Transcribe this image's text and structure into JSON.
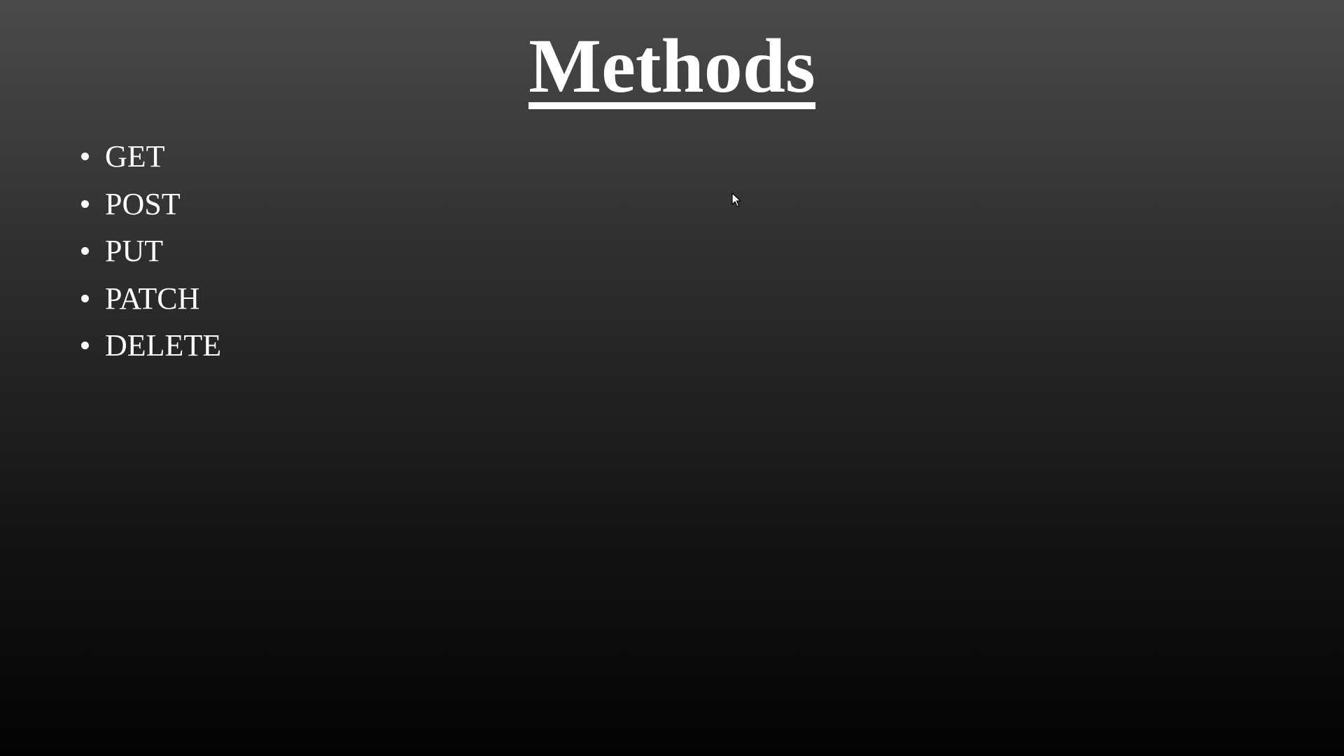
{
  "slide": {
    "title": "Methods",
    "bullets": [
      {
        "label": "GET"
      },
      {
        "label": "POST"
      },
      {
        "label": "PUT"
      },
      {
        "label": "PATCH"
      },
      {
        "label": "DELETE"
      }
    ]
  },
  "colors": {
    "text": "#ffffff",
    "background_top": "#4a4a4a",
    "background_bottom": "#030303"
  },
  "icons": {
    "bullet": "bullet-dot-icon",
    "cursor": "mouse-pointer-icon"
  }
}
